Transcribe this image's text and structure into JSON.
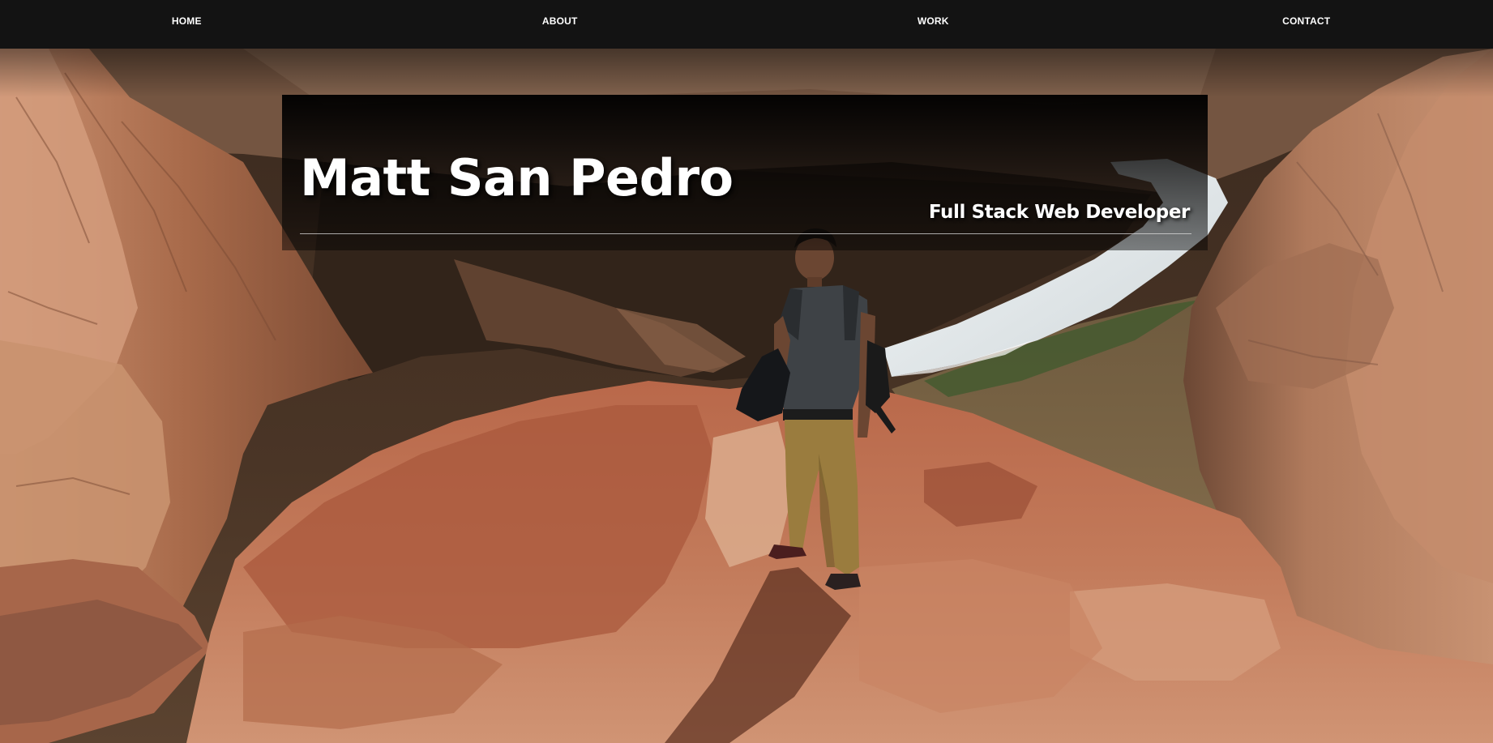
{
  "nav": {
    "items": [
      {
        "label": "HOME"
      },
      {
        "label": "ABOUT"
      },
      {
        "label": "WORK"
      },
      {
        "label": "CONTACT"
      }
    ]
  },
  "hero": {
    "name": "Matt San Pedro",
    "tagline": "Full Stack Web Developer",
    "image": "hiker-standing-on-canyon-rim-above-river"
  },
  "colors": {
    "nav_background": "#131313",
    "nav_text": "#ffffff",
    "title_text": "#ffffff",
    "rock": "#b8704a",
    "river": "#e9eef0"
  }
}
